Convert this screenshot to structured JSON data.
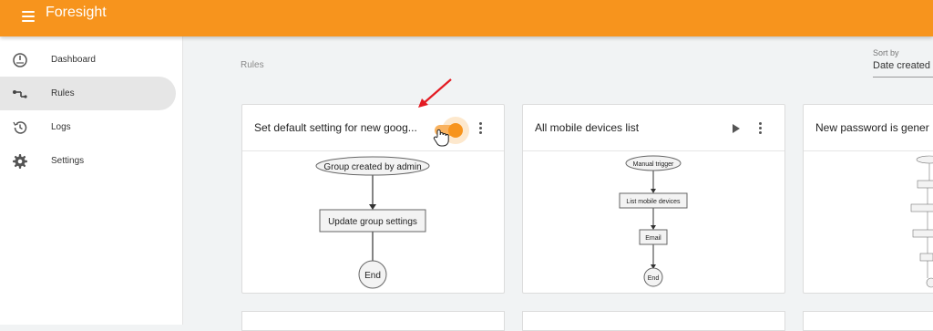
{
  "app": {
    "title": "Foresight"
  },
  "sidebar": {
    "items": [
      {
        "label": "Dashboard",
        "icon": "dashboard-gauge-icon",
        "active": false
      },
      {
        "label": "Rules",
        "icon": "rules-icon",
        "active": true
      },
      {
        "label": "Logs",
        "icon": "history-icon",
        "active": false
      },
      {
        "label": "Settings",
        "icon": "gear-icon",
        "active": false
      }
    ]
  },
  "main": {
    "section_label": "Rules",
    "sort": {
      "caption": "Sort by",
      "value": "Date created"
    }
  },
  "cards": [
    {
      "title": "Set default setting for new goog...",
      "toggle_on": true,
      "flow": [
        "Group created by admin",
        "Update group settings",
        "End"
      ]
    },
    {
      "title": "All mobile devices list",
      "flow": [
        "Manual trigger",
        "List mobile devices",
        "Email",
        "End"
      ]
    },
    {
      "title": "New password is gener"
    }
  ],
  "colors": {
    "accent": "#f7941d",
    "toggle": "#f7941d"
  }
}
